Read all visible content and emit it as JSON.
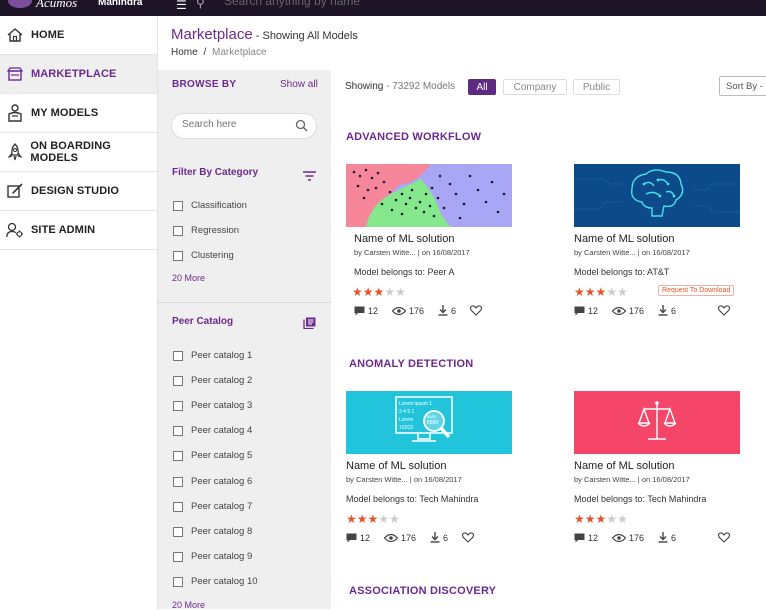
{
  "topbar": {
    "brand": "Acumos",
    "brand_sub": "Mahindra",
    "search_placeholder": "Search anything by name"
  },
  "nav": {
    "items": [
      {
        "label": "HOME",
        "icon": "home-icon"
      },
      {
        "label": "MARKETPLACE",
        "icon": "store-icon",
        "active": true
      },
      {
        "label": "MY MODELS",
        "icon": "user-model-icon"
      },
      {
        "label": "ON BOARDING MODELS",
        "icon": "rocket-icon"
      },
      {
        "label": "DESIGN STUDIO",
        "icon": "design-icon"
      },
      {
        "label": "SITE ADMIN",
        "icon": "admin-icon"
      }
    ]
  },
  "header": {
    "title": "Marketplace",
    "subtitle": " - Showing All Models",
    "crumb_home": "Home",
    "crumb_sep": "/",
    "crumb_current": "Marketplace"
  },
  "browse": {
    "title": "BROWSE BY",
    "show_all": "Show all",
    "search_placeholder": "Search here",
    "category_title": "Filter By Category",
    "categories": [
      "Classification",
      "Regression",
      "Clustering"
    ],
    "category_more": "20 More",
    "peer_title": "Peer Catalog",
    "peers": [
      "Peer catalog 1",
      "Peer catalog 2",
      "Peer catalog 3",
      "Peer catalog 4",
      "Peer catalog 5",
      "Peer catalog 6",
      "Peer catalog 7",
      "Peer catalog 8",
      "Peer catalog 9",
      "Peer catalog 10"
    ],
    "peer_more": "20 More"
  },
  "toolbar": {
    "showing_label": "Showing",
    "showing_count": " - 73292 Models",
    "filters": [
      "All",
      "Company",
      "Public"
    ],
    "sort_label": "Sort By -"
  },
  "sections": [
    {
      "title": "ADVANCED WORKFLOW"
    },
    {
      "title": "ANOMALY DETECTION"
    },
    {
      "title": "ASSOCIATION DISCOVERY"
    }
  ],
  "cards": [
    {
      "name": "Name of ML solution",
      "by": "by Carsten Witte...",
      "date": "| on 16/08/2017",
      "belongs": "Model belongs to: Peer A",
      "rating": 3,
      "comments": "12",
      "views": "176",
      "downloads": "6",
      "request": ""
    },
    {
      "name": "Name of ML solution",
      "by": "by Carsten Witte...",
      "date": "| on 16/08/2017",
      "belongs": "Model belongs to: AT&T",
      "rating": 3,
      "comments": "12",
      "views": "176",
      "downloads": "6",
      "request": "Request To Download"
    },
    {
      "name": "Name of ML solution",
      "by": "by Carsten Witte...",
      "date": "| on 16/08/2017",
      "belongs": "Model belongs to: Tech Mahindra",
      "rating": 3,
      "comments": "12",
      "views": "176",
      "downloads": "6",
      "request": ""
    },
    {
      "name": "Name of ML solution",
      "by": "by Carsten Witte...",
      "date": "| on 16/08/2017",
      "belongs": "Model belongs to: Tech Mahindra",
      "rating": 3,
      "comments": "12",
      "views": "176",
      "downloads": "6",
      "request": ""
    }
  ],
  "thumb_text": {
    "l1": "Lorem ipsum 1",
    "l2": "3 4 5 1",
    "l3": "Lorem",
    "l4": "10203",
    "l5": "5680",
    "l6": "5689"
  },
  "colors": {
    "brand": "#6c2a8e",
    "star": "#e4542c",
    "anomaly_cyan": "#22c4dc",
    "anomaly_pink": "#f5466a",
    "workflow_blue": "#0d4a8a"
  }
}
